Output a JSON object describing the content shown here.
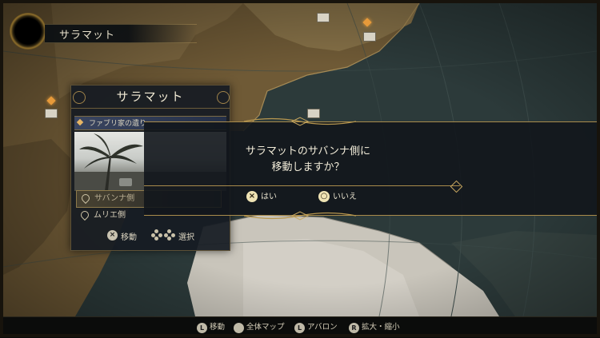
{
  "location": {
    "name": "サラマット"
  },
  "panel": {
    "title": "サラマット",
    "subtitle": "ファブリ家の遺り",
    "options": [
      {
        "label": "サバンナ側",
        "selected": true
      },
      {
        "label": "ムリエ側",
        "selected": false
      }
    ],
    "footer": {
      "move_key": "×",
      "move_label": "移動",
      "select_label": "選択"
    }
  },
  "dialog": {
    "message": "サラマットのサバンナ側に\n移動しますか？",
    "confirm": {
      "key": "×",
      "label": "はい"
    },
    "cancel": {
      "key": "○",
      "label": "いいえ"
    }
  },
  "bottom_hints": [
    {
      "key": "L",
      "label": "移動"
    },
    {
      "key": "",
      "label": "全体マップ"
    },
    {
      "key": "L",
      "label": "アバロン"
    },
    {
      "key": "R",
      "label": "拡大・縮小"
    }
  ],
  "colors": {
    "sea": "#2c3a3a",
    "land": "#6f5a36",
    "desert": "#c9c5bb",
    "gold": "#a98b4b",
    "marker": "#e79a3a"
  },
  "icons": [
    "emblem-icon",
    "map-diamond-icon",
    "chest-icon",
    "pin-icon",
    "cross-button-icon",
    "circle-button-icon",
    "dpad-icon"
  ]
}
